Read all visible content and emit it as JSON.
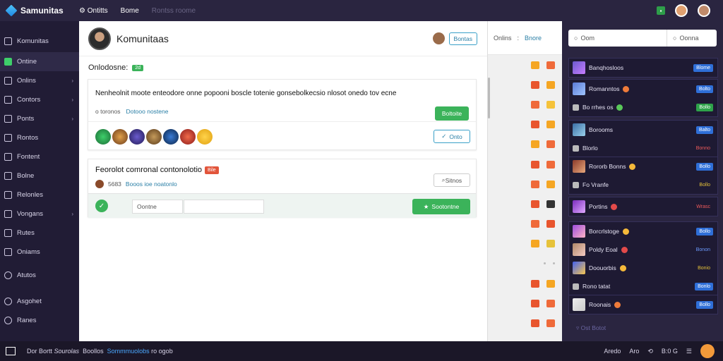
{
  "app": {
    "name": "Samunitas"
  },
  "topnav": {
    "items": [
      "Ontitts",
      "Bome",
      "Rontss roome"
    ]
  },
  "sidebar": {
    "brand": "Komunitas",
    "items": [
      {
        "label": "Ontine",
        "active": true
      },
      {
        "label": "Onlins",
        "chevron": true
      },
      {
        "label": "Contors",
        "chevron": true
      },
      {
        "label": "Ponts",
        "chevron": true
      },
      {
        "label": "Rontos"
      },
      {
        "label": "Fontent"
      },
      {
        "label": "Bolne"
      },
      {
        "label": "Relonles"
      },
      {
        "label": "Vongans",
        "chevron": true
      },
      {
        "label": "Rutes"
      },
      {
        "label": "Oniams"
      },
      {
        "label": "Atutos"
      },
      {
        "label": "Asgohet"
      },
      {
        "label": "Ranes"
      }
    ]
  },
  "main": {
    "title": "Komunitaas",
    "head_button": "Bontas",
    "section_label": "Onlodosne:",
    "section_tag": "2d",
    "card1": {
      "text": "Nenheolnit moote enteodore onne popooni boscle totenie gonsebolkecsio nlosot onedo tov ecne",
      "meta": "o toronos",
      "link": "Dotooo nostene",
      "button": "Boltoite",
      "action": "Onto"
    },
    "card2": {
      "title": "Feorolot comronal contonolotio",
      "tag": "Bile",
      "meta": "5683",
      "link": "Booos ioe noatonlo",
      "button": "Sitnos",
      "input1": "Oontne",
      "input2": "",
      "submit": "Sootontne"
    }
  },
  "midcol": {
    "head_left": "Onlins",
    "head_right": "Bnore"
  },
  "right": {
    "search_placeholder": "Oom",
    "filter": "Oonna",
    "groups": [
      [
        {
          "title": "Banqhosloos",
          "badge": "Blome",
          "thumb": true
        }
      ],
      [
        {
          "title": "Romanntos",
          "badge": "Bolto",
          "thumb": true,
          "coin": "o"
        },
        {
          "title": "Bo rrhes os",
          "badge": "Bollo",
          "small": true,
          "coin": "g",
          "color": "green"
        }
      ],
      [
        {
          "title": "Borooms",
          "badge": "Balto",
          "thumb": true
        },
        {
          "title": "Blorlo",
          "badge": "Bonno",
          "small": true,
          "color": "red"
        }
      ],
      [
        {
          "title": "Rororb Bonns",
          "badge": "Bollo",
          "thumb": true,
          "coin": "y"
        },
        {
          "title": "Fo Vranfe",
          "badge": "Bollo",
          "small": true,
          "color": "yellow"
        }
      ],
      [
        {
          "title": "Portins",
          "badge": "Wrasc",
          "thumb": true,
          "coin": "r",
          "color": "red"
        }
      ],
      [
        {
          "title": "Borcrlstoge",
          "badge": "Bollo",
          "thumb": true,
          "coin": "y"
        },
        {
          "title": "Poldy Eoal",
          "badge": "Bonon",
          "thumb": true,
          "coin": "r",
          "color": "blue2"
        },
        {
          "title": "Doouorbis",
          "badge": "Bonio",
          "thumb": true,
          "coin": "y",
          "color": "yellow"
        },
        {
          "title": "Rono tatat",
          "badge": "Bonlo",
          "small": true
        }
      ],
      [
        {
          "title": "Roonais",
          "badge": "Bollo",
          "thumb": true,
          "coin": "o"
        }
      ]
    ],
    "footer": "Ost Botot"
  },
  "bottombar": {
    "text1": "Dor Bortt",
    "text2": "Sourolas",
    "text3": "Boollos",
    "highlight": "Sommmuolobs",
    "text4": "ro ogob",
    "right1": "Aredo",
    "right2": "Aro",
    "right3": "B:0 G"
  }
}
